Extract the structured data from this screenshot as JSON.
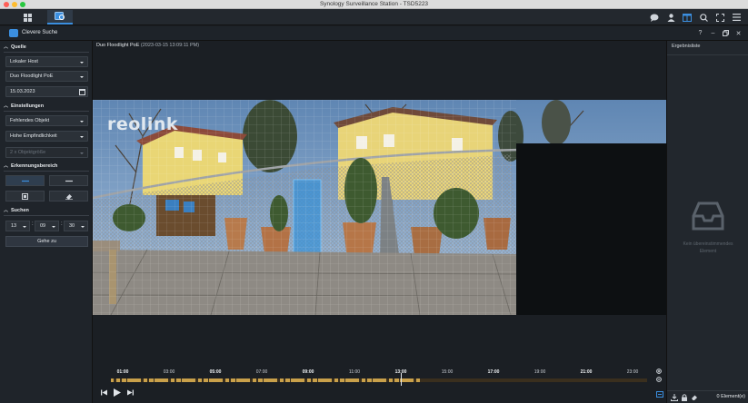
{
  "window": {
    "title": "Synology Surveillance Station - TSD5223"
  },
  "subheader": {
    "title": "Clevere Suche"
  },
  "left": {
    "sections": {
      "source": "Quelle",
      "settings": "Einstellungen",
      "detection": "Erkennungsbereich",
      "search": "Suchen"
    },
    "host": "Lokaler Host",
    "camera": "Duo Floodlight PoE",
    "date": "15.03.2023",
    "event_type": "Fehlendes Objekt",
    "sensitivity": "Hohe Empfindlichkeit",
    "object_size": "2 x Objektgröße",
    "time": {
      "hour": "13",
      "minute": "09",
      "second": "30"
    },
    "goto_label": "Gehe zu"
  },
  "center": {
    "camera_name": "Duo Floodlight PoE",
    "timestamp": "(2023-03-15 13:09:11 PM)",
    "overlay_logo": "reolink",
    "timeline_labels": [
      "01:00",
      "03:00",
      "05:00",
      "07:00",
      "09:00",
      "11:00",
      "13:00",
      "15:00",
      "17:00",
      "19:00",
      "21:00",
      "23:00"
    ],
    "timeline_bold": [
      "01:00",
      "05:00",
      "09:00",
      "13:00",
      "17:00",
      "21:00"
    ]
  },
  "right": {
    "title": "Ergebnisliste",
    "empty_text": "Kein übereinstimmendes Element",
    "count": "0 Element(e)"
  },
  "colors": {
    "accent": "#3b8fe0",
    "recording": "#c9a04a"
  }
}
